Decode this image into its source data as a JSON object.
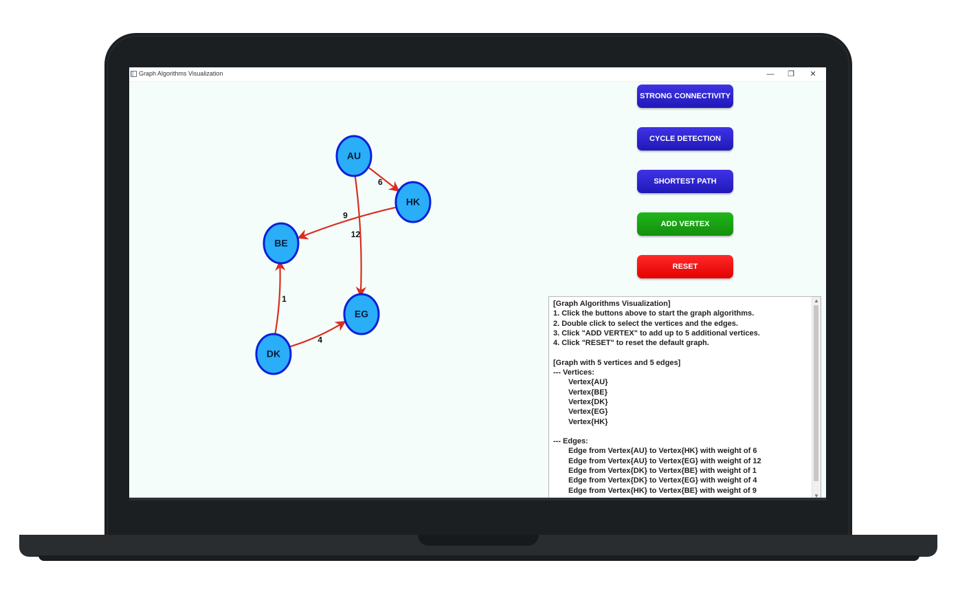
{
  "window": {
    "title": "Graph Algorithms Visualization",
    "controls": {
      "minimize": "—",
      "maximize": "❐",
      "close": "✕"
    }
  },
  "graph": {
    "node_fill": "#29aef7",
    "node_stroke": "#0b1fd8",
    "edge_color": "#d92d20",
    "nodes": [
      {
        "id": "AU",
        "label": "AU"
      },
      {
        "id": "HK",
        "label": "HK"
      },
      {
        "id": "BE",
        "label": "BE"
      },
      {
        "id": "EG",
        "label": "EG"
      },
      {
        "id": "DK",
        "label": "DK"
      }
    ],
    "edges": [
      {
        "from": "AU",
        "to": "HK",
        "weight": "6"
      },
      {
        "from": "AU",
        "to": "EG",
        "weight": "12"
      },
      {
        "from": "DK",
        "to": "BE",
        "weight": "1"
      },
      {
        "from": "DK",
        "to": "EG",
        "weight": "4"
      },
      {
        "from": "HK",
        "to": "BE",
        "weight": "9"
      }
    ]
  },
  "buttons": {
    "strong_connectivity": "STRONG CONNECTIVITY",
    "cycle_detection": "CYCLE DETECTION",
    "shortest_path": "SHORTEST PATH",
    "add_vertex": "ADD VERTEX",
    "reset": "RESET"
  },
  "console": {
    "lines": [
      "[Graph Algorithms Visualization]",
      "1. Click the buttons above to start the graph algorithms.",
      "2. Double click to select the vertices and the edges.",
      "3. Click \"ADD VERTEX\" to add up to 5 additional vertices.",
      "4. Click \"RESET\" to reset the default graph.",
      "",
      "[Graph with 5 vertices and 5 edges]",
      "--- Vertices:",
      "Vertex{AU}",
      "Vertex{BE}",
      "Vertex{DK}",
      "Vertex{EG}",
      "Vertex{HK}",
      "",
      "--- Edges:",
      "Edge from Vertex{AU} to Vertex{HK} with weight of 6",
      "Edge from Vertex{AU} to Vertex{EG} with weight of 12",
      "Edge from Vertex{DK} to Vertex{BE} with weight of 1",
      "Edge from Vertex{DK} to Vertex{EG} with weight of 4",
      "Edge from Vertex{HK} to Vertex{BE} with weight of 9"
    ]
  }
}
